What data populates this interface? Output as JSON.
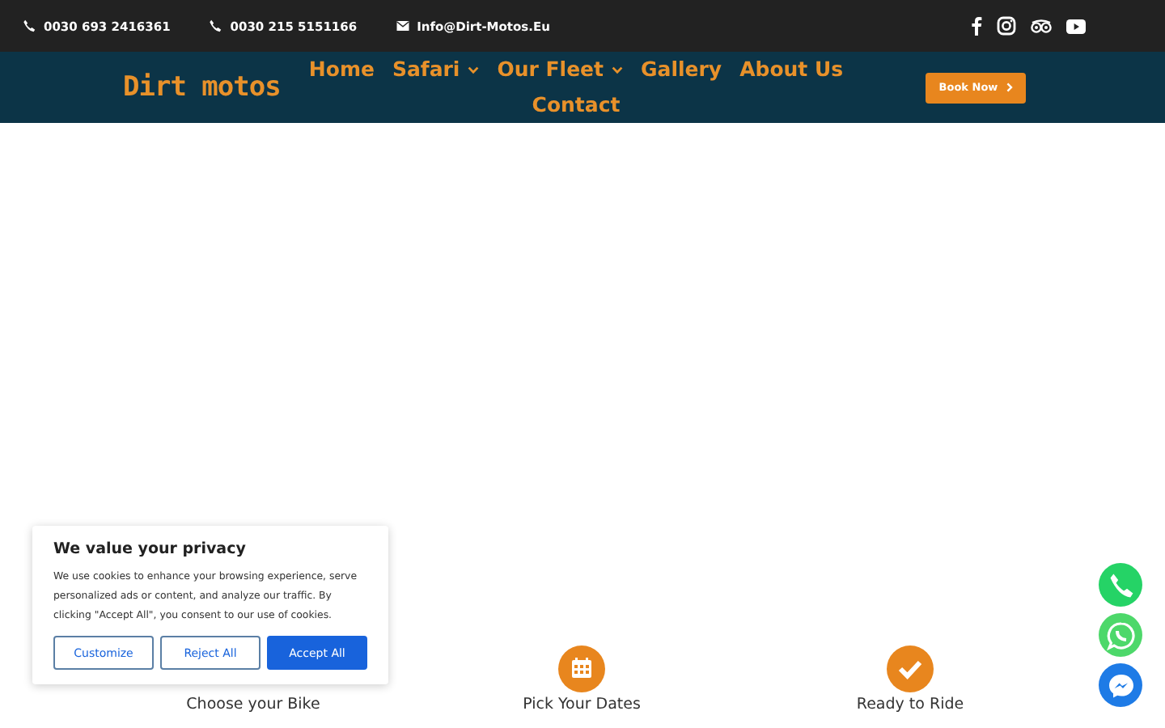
{
  "topbar": {
    "contacts": [
      {
        "kind": "phone",
        "text": "0030 693 2416361"
      },
      {
        "kind": "phone",
        "text": "0030 215 5151166"
      },
      {
        "kind": "mail",
        "text": "Info@Dirt-Motos.Eu"
      }
    ],
    "social": [
      {
        "kind": "facebook"
      },
      {
        "kind": "instagram"
      },
      {
        "kind": "tripadvisor"
      },
      {
        "kind": "youtube"
      }
    ]
  },
  "nav": {
    "logo": "Dirt motos",
    "items": [
      {
        "label": "Home",
        "dropdown": false
      },
      {
        "label": "Safari",
        "dropdown": true
      },
      {
        "label": "Our Fleet",
        "dropdown": true
      },
      {
        "label": "Gallery",
        "dropdown": false
      },
      {
        "label": "About Us",
        "dropdown": false
      },
      {
        "label": "Contact",
        "dropdown": false
      }
    ],
    "button": "Book Now"
  },
  "steps": [
    {
      "kind": "hidden",
      "label": "Choose your Bike"
    },
    {
      "kind": "calendar",
      "label": "Pick Your Dates"
    },
    {
      "kind": "check",
      "label": "Ready to Ride"
    }
  ],
  "cookie": {
    "title": "We value your privacy",
    "text": "We use cookies to enhance your browsing experience, serve personalized ads or content, and analyze our traffic. By clicking \"Accept All\", you consent to our use of cookies.",
    "buttons": [
      {
        "label": "Customize",
        "primary": false
      },
      {
        "label": "Reject All",
        "primary": false
      },
      {
        "label": "Accept All",
        "primary": true
      }
    ]
  },
  "floating": [
    {
      "kind": "phone"
    },
    {
      "kind": "whatsapp"
    },
    {
      "kind": "messenger"
    }
  ]
}
